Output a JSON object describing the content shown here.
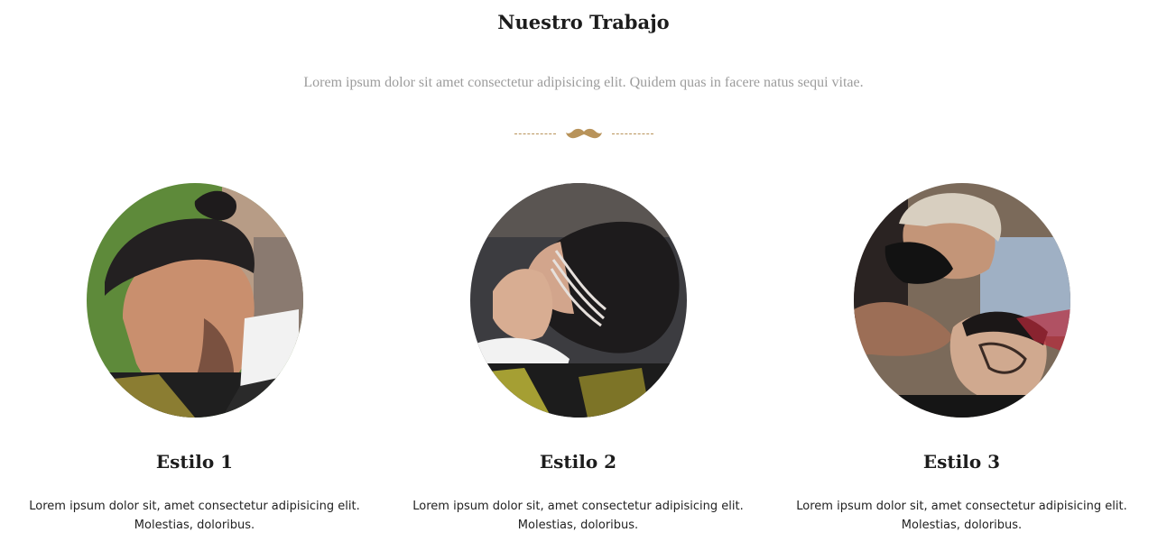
{
  "section": {
    "title": "Nuestro Trabajo",
    "subtitle": "Lorem ipsum dolor sit amet consectetur adipisicing elit. Quidem quas in facere natus sequi vitae.",
    "divider_icon": "mustache-icon",
    "accent_color": "#b8935a"
  },
  "cards": [
    {
      "title": "Estilo 1",
      "text": "Lorem ipsum dolor sit, amet consectetur adipisicing elit. Molestias, doloribus.",
      "photo": "haircut-photo-1"
    },
    {
      "title": "Estilo 2",
      "text": "Lorem ipsum dolor sit, amet consectetur adipisicing elit. Molestias, doloribus.",
      "photo": "haircut-photo-2"
    },
    {
      "title": "Estilo 3",
      "text": "Lorem ipsum dolor sit, amet consectetur adipisicing elit. Molestias, doloribus.",
      "photo": "haircut-photo-3"
    }
  ]
}
